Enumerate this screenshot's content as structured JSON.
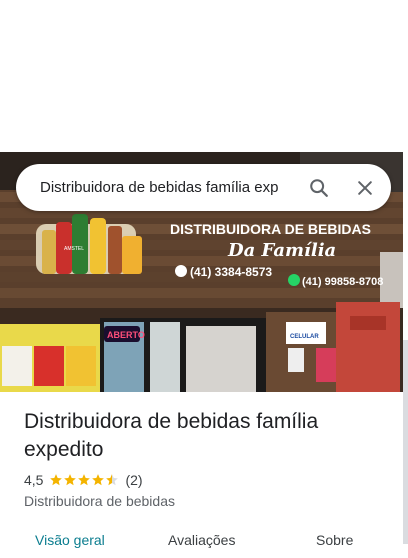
{
  "search": {
    "query": "Distribuidora de bebidas família exp"
  },
  "photo": {
    "sign_title": "DISTRIBUIDORA DE BEBIDAS",
    "sign_subtitle": "Da Família",
    "phone_1": "(41) 3384-8573",
    "phone_2": "(41) 99858-8708",
    "neon_sign": "ABERTO",
    "side_sign": "CELULAR",
    "beer_label": "AMSTEL"
  },
  "place": {
    "name": "Distribuidora de bebidas família expedito",
    "rating": "4,5",
    "rating_value": 4.5,
    "review_count": "(2)",
    "category": "Distribuidora de bebidas"
  },
  "tabs": [
    {
      "label": "Visão geral",
      "active": true
    },
    {
      "label": "Avaliações",
      "active": false
    },
    {
      "label": "Sobre",
      "active": false
    }
  ],
  "colors": {
    "accent": "#0b7d8f",
    "star": "#f4b400",
    "sign_text": "#ffffff"
  }
}
